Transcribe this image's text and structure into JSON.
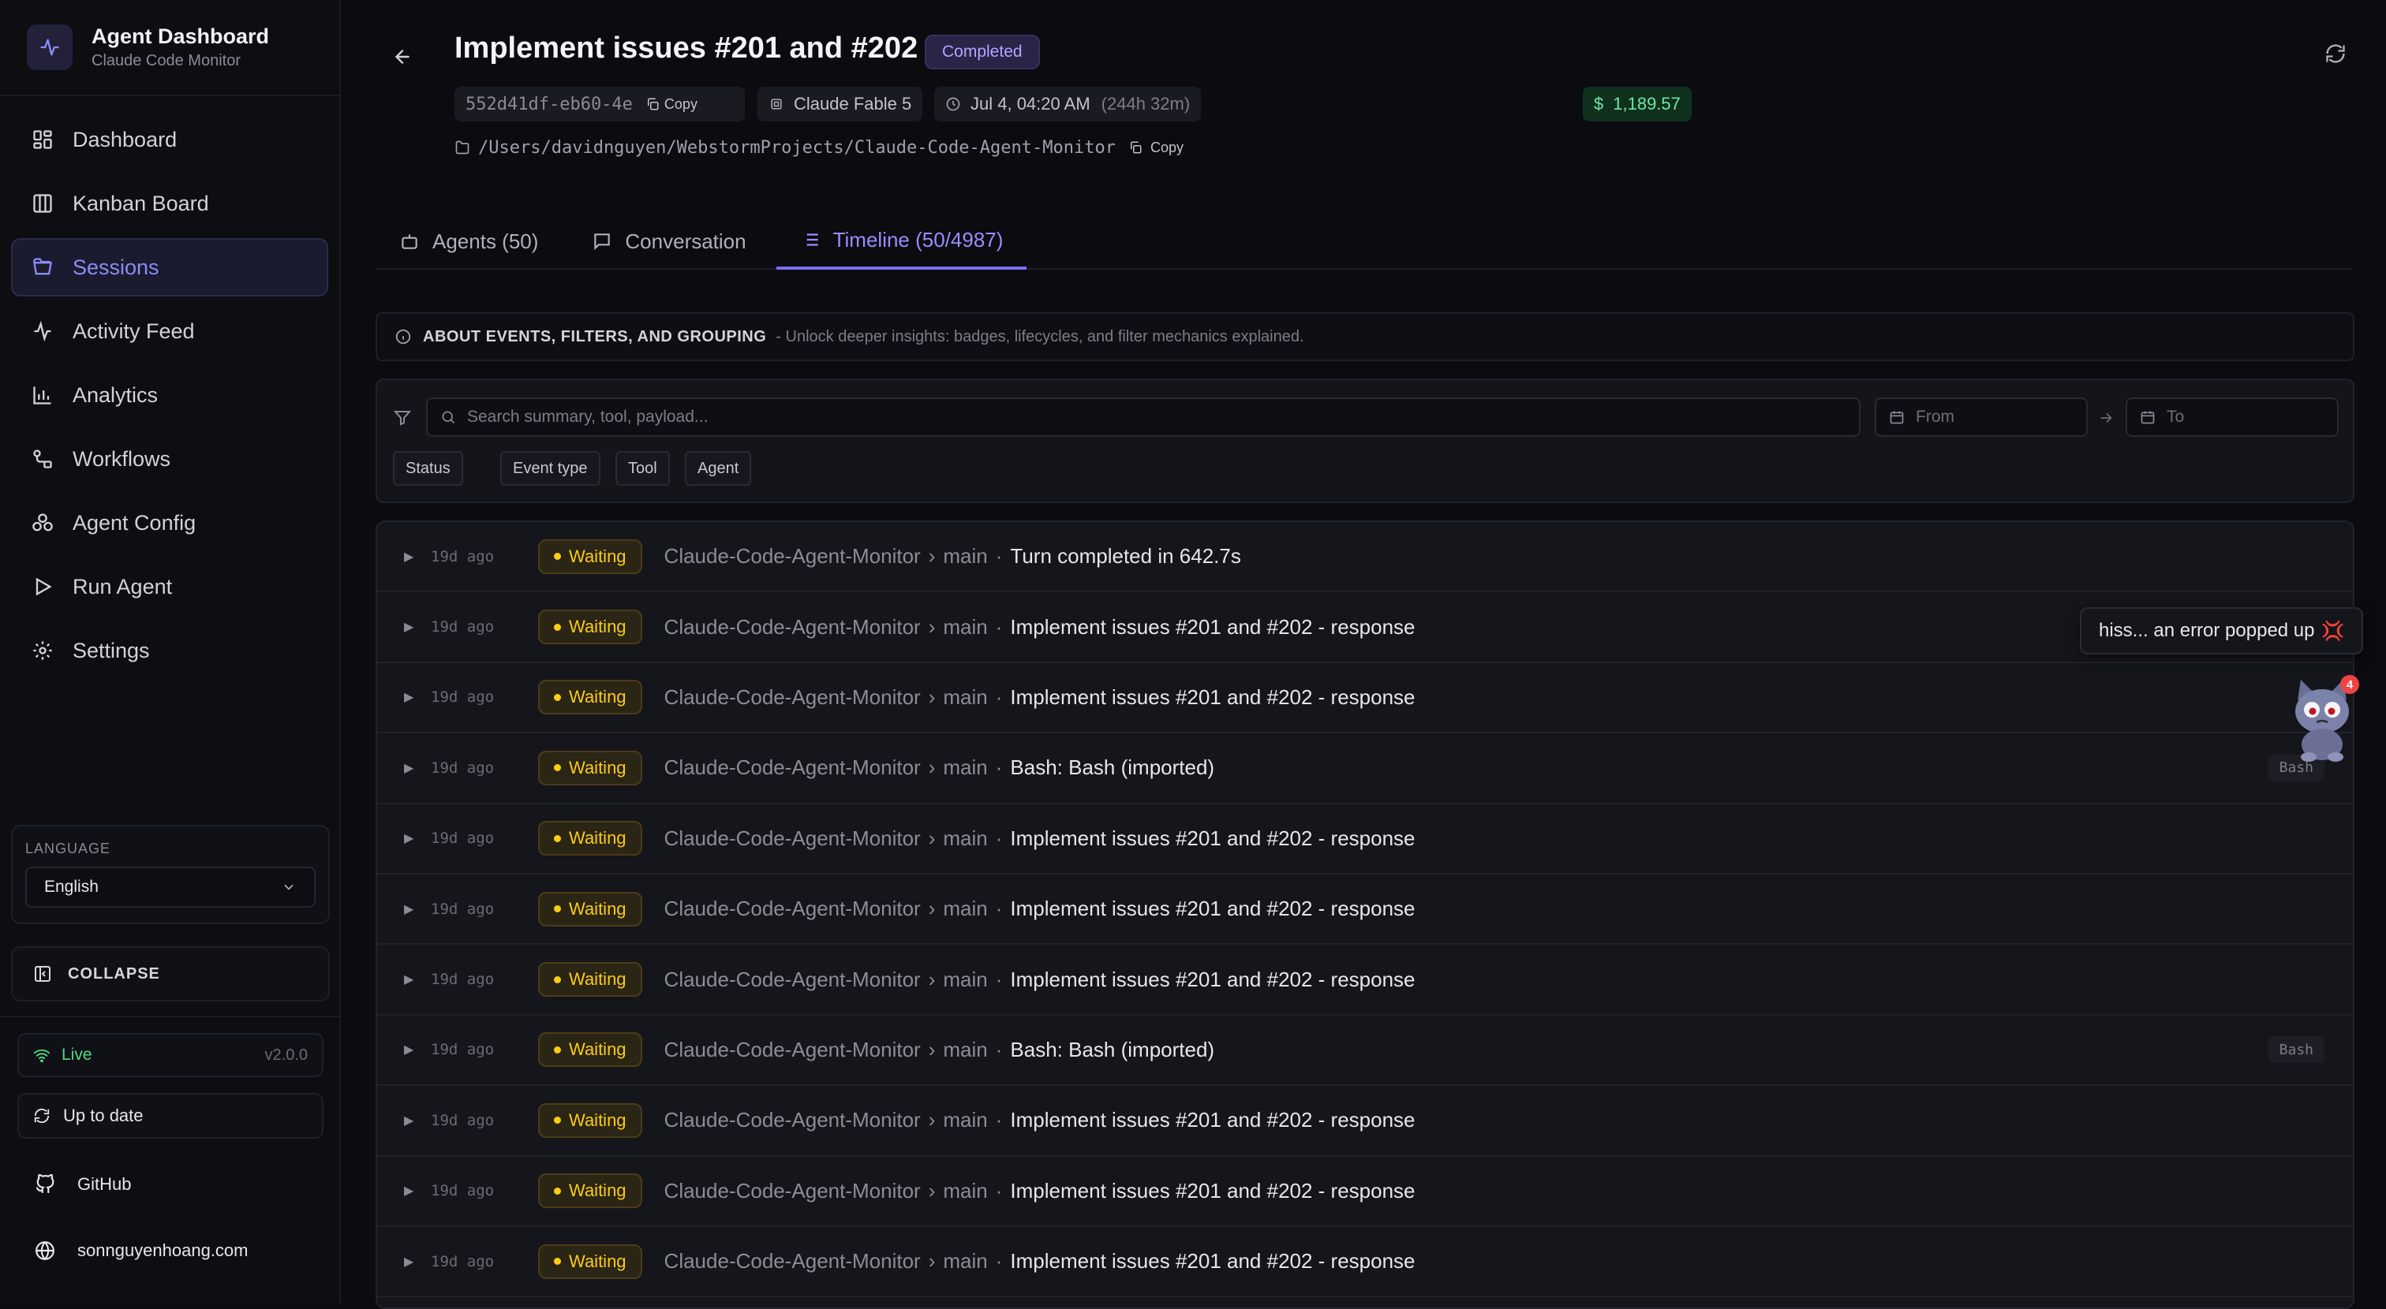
{
  "sidebar": {
    "brand": {
      "title": "Agent Dashboard",
      "subtitle": "Claude Code Monitor",
      "logo_icon": "activity-icon"
    },
    "nav": [
      {
        "label": "Dashboard",
        "icon": "dashboard-icon"
      },
      {
        "label": "Kanban Board",
        "icon": "kanban-icon"
      },
      {
        "label": "Sessions",
        "icon": "folder-open-icon",
        "active": true
      },
      {
        "label": "Activity Feed",
        "icon": "activity-icon"
      },
      {
        "label": "Analytics",
        "icon": "bar-chart-icon"
      },
      {
        "label": "Workflows",
        "icon": "workflow-icon"
      },
      {
        "label": "Agent Config",
        "icon": "bot-config-icon"
      },
      {
        "label": "Run Agent",
        "icon": "play-icon"
      },
      {
        "label": "Settings",
        "icon": "gear-icon"
      }
    ],
    "language": {
      "label": "LANGUAGE",
      "value": "English"
    },
    "collapse_label": "COLLAPSE",
    "status": {
      "live_label": "Live",
      "version": "v2.0.0",
      "update_label": "Up to date"
    },
    "links": [
      {
        "label": "GitHub",
        "icon": "github-icon"
      },
      {
        "label": "sonnguyenhoang.com",
        "icon": "globe-icon"
      }
    ]
  },
  "session": {
    "title": "Implement issues #201 and #202",
    "status": "Completed",
    "id": "552d41df-eb60-4e",
    "copy_label": "Copy",
    "model": "Claude Fable 5",
    "started": "Jul 4, 04:20 AM",
    "duration": "(244h 32m)",
    "cost_symbol": "$",
    "cost": "1,189.57",
    "path": "/Users/davidnguyen/WebstormProjects/Claude-Code-Agent-Monitor"
  },
  "tabs": [
    {
      "label": "Agents (50)",
      "icon": "bot-icon"
    },
    {
      "label": "Conversation",
      "icon": "message-icon"
    },
    {
      "label": "Timeline (50/4987)",
      "icon": "list-icon",
      "active": true
    }
  ],
  "info": {
    "title": "ABOUT EVENTS, FILTERS, AND GROUPING",
    "description": "- Unlock deeper insights: badges, lifecycles, and filter mechanics explained."
  },
  "filters": {
    "search_placeholder": "Search summary, tool, payload...",
    "from_placeholder": "From",
    "to_placeholder": "To",
    "chips": [
      "Status",
      "Event type",
      "Tool",
      "Agent"
    ]
  },
  "events": [
    {
      "ago": "19d ago",
      "status": "Waiting",
      "project": "Claude-Code-Agent-Monitor",
      "branch": "main",
      "summary": "Turn completed in 642.7s",
      "tool": ""
    },
    {
      "ago": "19d ago",
      "status": "Waiting",
      "project": "Claude-Code-Agent-Monitor",
      "branch": "main",
      "summary": "Implement issues #201 and #202 - response",
      "tool": ""
    },
    {
      "ago": "19d ago",
      "status": "Waiting",
      "project": "Claude-Code-Agent-Monitor",
      "branch": "main",
      "summary": "Implement issues #201 and #202 - response",
      "tool": ""
    },
    {
      "ago": "19d ago",
      "status": "Waiting",
      "project": "Claude-Code-Agent-Monitor",
      "branch": "main",
      "summary": "Bash: Bash (imported)",
      "tool": "Bash"
    },
    {
      "ago": "19d ago",
      "status": "Waiting",
      "project": "Claude-Code-Agent-Monitor",
      "branch": "main",
      "summary": "Implement issues #201 and #202 - response",
      "tool": ""
    },
    {
      "ago": "19d ago",
      "status": "Waiting",
      "project": "Claude-Code-Agent-Monitor",
      "branch": "main",
      "summary": "Implement issues #201 and #202 - response",
      "tool": ""
    },
    {
      "ago": "19d ago",
      "status": "Waiting",
      "project": "Claude-Code-Agent-Monitor",
      "branch": "main",
      "summary": "Implement issues #201 and #202 - response",
      "tool": ""
    },
    {
      "ago": "19d ago",
      "status": "Waiting",
      "project": "Claude-Code-Agent-Monitor",
      "branch": "main",
      "summary": "Bash: Bash (imported)",
      "tool": "Bash"
    },
    {
      "ago": "19d ago",
      "status": "Waiting",
      "project": "Claude-Code-Agent-Monitor",
      "branch": "main",
      "summary": "Implement issues #201 and #202 - response",
      "tool": ""
    },
    {
      "ago": "19d ago",
      "status": "Waiting",
      "project": "Claude-Code-Agent-Monitor",
      "branch": "main",
      "summary": "Implement issues #201 and #202 - response",
      "tool": ""
    },
    {
      "ago": "19d ago",
      "status": "Waiting",
      "project": "Claude-Code-Agent-Monitor",
      "branch": "main",
      "summary": "Implement issues #201 and #202 - response",
      "tool": ""
    }
  ],
  "mascot": {
    "message": "hiss... an error popped up",
    "burst": "💢",
    "badge_count": "4"
  },
  "colors": {
    "accent": "#8b8cf5",
    "waiting": "#facc15",
    "live": "#4ade80",
    "cost": "#6ee7a3",
    "error": "#ef4444"
  }
}
